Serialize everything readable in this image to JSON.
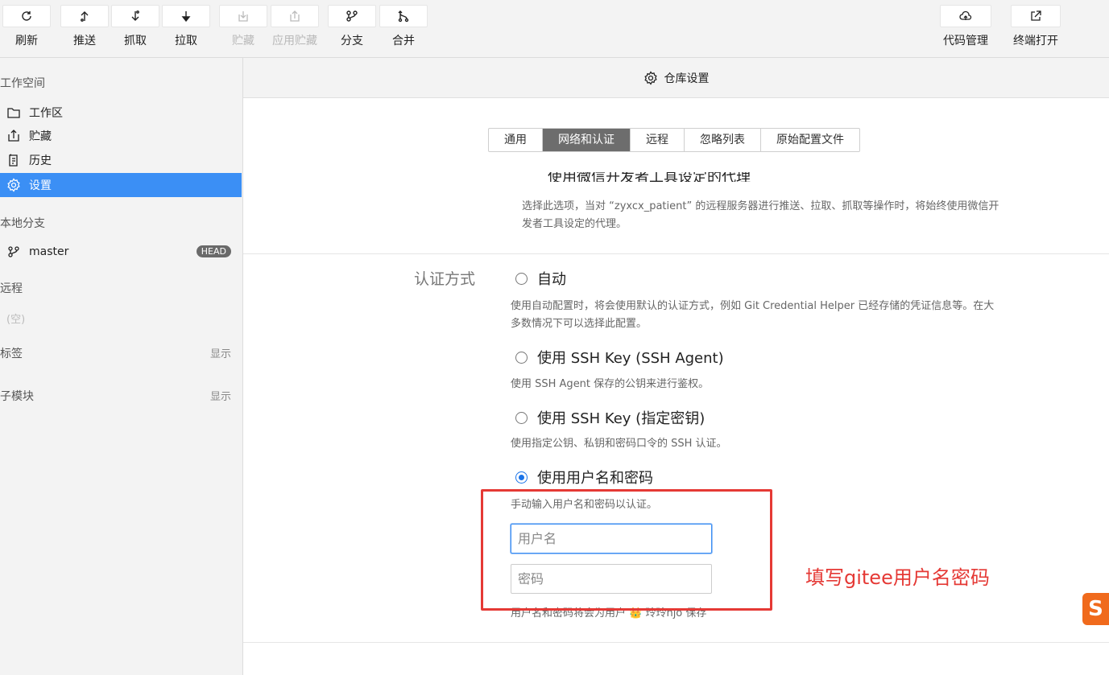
{
  "toolbar": {
    "left": [
      {
        "label": "刷新",
        "icon": "refresh-icon",
        "disabled": false
      },
      {
        "label": "推送",
        "icon": "push-icon",
        "disabled": false
      },
      {
        "label": "抓取",
        "icon": "fetch-icon",
        "disabled": false
      },
      {
        "label": "拉取",
        "icon": "pull-icon",
        "disabled": false
      },
      {
        "label": "贮藏",
        "icon": "stash-icon",
        "disabled": true
      },
      {
        "label": "应用贮藏",
        "icon": "apply-stash-icon",
        "disabled": true
      },
      {
        "label": "分支",
        "icon": "branch-icon",
        "disabled": false
      },
      {
        "label": "合并",
        "icon": "merge-icon",
        "disabled": false
      }
    ],
    "right": [
      {
        "label": "代码管理",
        "icon": "cloud-icon"
      },
      {
        "label": "终端打开",
        "icon": "external-link-icon"
      }
    ]
  },
  "sidebar": {
    "workspace_title": "工作空间",
    "items": [
      {
        "label": "工作区",
        "icon": "folder-icon"
      },
      {
        "label": "贮藏",
        "icon": "stash-icon"
      },
      {
        "label": "历史",
        "icon": "history-icon"
      },
      {
        "label": "设置",
        "icon": "gear-icon",
        "active": true
      }
    ],
    "local_branches_title": "本地分支",
    "branch": {
      "name": "master",
      "badge": "HEAD"
    },
    "remote_title": "远程",
    "remote_empty": "(空)",
    "tags_title": "标签",
    "tags_action": "显示",
    "submodules_title": "子模块",
    "submodules_action": "显示"
  },
  "main": {
    "header_title": "仓库设置",
    "tabs": [
      {
        "label": "通用"
      },
      {
        "label": "网络和认证",
        "active": true
      },
      {
        "label": "远程"
      },
      {
        "label": "忽略列表"
      },
      {
        "label": "原始配置文件"
      }
    ],
    "proxy_title_partial": "使用微信开发者工具设定的代理",
    "proxy_desc": "选择此选项，当对 “zyxcx_patient” 的远程服务器进行推送、拉取、抓取等操作时，将始终使用微信开发者工具设定的代理。",
    "auth_label": "认证方式",
    "auth_options": [
      {
        "label": "自动",
        "desc": "使用自动配置时，将会使用默认的认证方式，例如 Git Credential Helper 已经存储的凭证信息等。在大多数情况下可以选择此配置。",
        "selected": false
      },
      {
        "label": "使用 SSH Key (SSH Agent)",
        "desc": "使用 SSH Agent 保存的公钥来进行鉴权。",
        "selected": false
      },
      {
        "label": "使用 SSH Key (指定密钥)",
        "desc": "使用指定公钥、私钥和密码口令的 SSH 认证。",
        "selected": false
      },
      {
        "label": "使用用户名和密码",
        "desc": "手动输入用户名和密码以认证。",
        "selected": true
      }
    ],
    "username_placeholder": "用户名",
    "password_placeholder": "密码",
    "save_note": "用户名和密码将会为用户 👑 玲玲hjo 保存"
  },
  "annotation": {
    "text": "填写gitee用户名密码",
    "color": "#e53935"
  },
  "colors": {
    "accent": "#3b8ff5",
    "active_tab": "#6d6d6d",
    "annotation": "#e53935"
  },
  "logo_glyph": "S"
}
